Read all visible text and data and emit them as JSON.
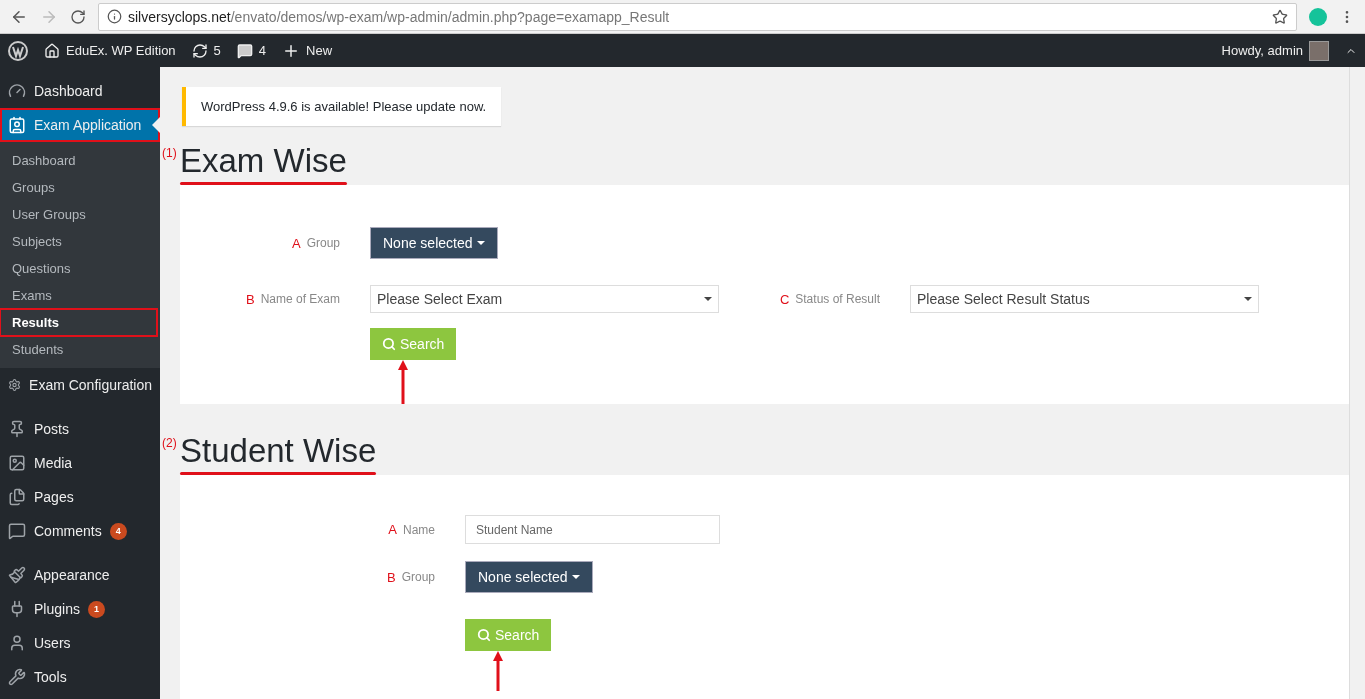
{
  "browser": {
    "url_host": "silversyclops.net",
    "url_path": "/envato/demos/wp-exam/wp-admin/admin.php?page=examapp_Result"
  },
  "admin_bar": {
    "site": "EduEx. WP Edition",
    "updates": "5",
    "comments": "4",
    "new": "New",
    "greeting": "Howdy, admin"
  },
  "sidebar": {
    "groups": [
      {
        "items": [
          {
            "label": "Dashboard",
            "current": false,
            "annotated": false
          },
          {
            "label": "Exam Application",
            "current": true,
            "annotated": true,
            "children": [
              {
                "label": "Dashboard",
                "selected": false,
                "annotated": false
              },
              {
                "label": "Groups",
                "selected": false,
                "annotated": false
              },
              {
                "label": "User Groups",
                "selected": false,
                "annotated": false
              },
              {
                "label": "Subjects",
                "selected": false,
                "annotated": false
              },
              {
                "label": "Questions",
                "selected": false,
                "annotated": false
              },
              {
                "label": "Exams",
                "selected": false,
                "annotated": false
              },
              {
                "label": "Results",
                "selected": true,
                "annotated": true
              },
              {
                "label": "Students",
                "selected": false,
                "annotated": false
              }
            ]
          },
          {
            "label": "Exam Configuration",
            "current": false,
            "annotated": false
          }
        ]
      },
      {
        "items": [
          {
            "label": "Posts",
            "current": false,
            "annotated": false
          },
          {
            "label": "Media",
            "current": false,
            "annotated": false
          },
          {
            "label": "Pages",
            "current": false,
            "annotated": false
          },
          {
            "label": "Comments",
            "current": false,
            "annotated": false,
            "badge": "4"
          }
        ]
      },
      {
        "items": [
          {
            "label": "Appearance",
            "current": false,
            "annotated": false
          },
          {
            "label": "Plugins",
            "current": false,
            "annotated": false,
            "badge": "1"
          },
          {
            "label": "Users",
            "current": false,
            "annotated": false
          },
          {
            "label": "Tools",
            "current": false,
            "annotated": false
          }
        ]
      }
    ]
  },
  "notice": "WordPress 4.9.6 is available! Please update now.",
  "sections": [
    {
      "marker": "(1)",
      "title": "Exam Wise",
      "rows": [
        {
          "fields": [
            {
              "marker": "A",
              "label": "Group",
              "kind": "dropdown",
              "value": "None selected"
            }
          ]
        },
        {
          "fields": [
            {
              "marker": "B",
              "label": "Name of Exam",
              "kind": "select",
              "value": "Please Select Exam"
            },
            {
              "marker": "C",
              "label": "Status of Result",
              "kind": "select",
              "value": "Please Select Result Status"
            }
          ]
        }
      ],
      "search": "Search"
    },
    {
      "marker": "(2)",
      "title": "Student Wise",
      "rows": [
        {
          "fields": [
            {
              "marker": "A",
              "label": "Name",
              "kind": "input",
              "placeholder": "Student Name"
            }
          ]
        },
        {
          "fields": [
            {
              "marker": "B",
              "label": "Group",
              "kind": "dropdown",
              "value": "None selected"
            }
          ]
        }
      ],
      "search": "Search"
    }
  ]
}
